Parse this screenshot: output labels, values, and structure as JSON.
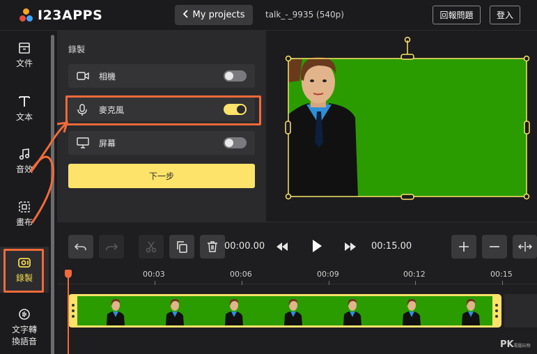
{
  "app": {
    "logo_text": "I23APPS",
    "logo_colors": [
      "#f5a623",
      "#e94e3c",
      "#3ea6ff"
    ]
  },
  "header": {
    "back_label": "My projects",
    "filename": "talk_-_9935 (540p)",
    "feedback_label": "回報問題",
    "login_label": "登入"
  },
  "sidebar": {
    "items": [
      {
        "label": "文件",
        "icon": "file-icon"
      },
      {
        "label": "文本",
        "icon": "text-icon"
      },
      {
        "label": "音效",
        "icon": "music-note-icon"
      },
      {
        "label": "畫布",
        "icon": "canvas-icon"
      },
      {
        "label": "錄製",
        "icon": "record-icon",
        "active": true
      },
      {
        "label": "文字轉換語音",
        "label_line1": "文字轉",
        "label_line2": "換語音",
        "icon": "text-to-speech-icon"
      }
    ]
  },
  "record_panel": {
    "title": "錄製",
    "options": [
      {
        "label": "相機",
        "icon": "camera-icon",
        "enabled": false
      },
      {
        "label": "麥克風",
        "icon": "microphone-icon",
        "enabled": true
      },
      {
        "label": "屏幕",
        "icon": "monitor-icon",
        "enabled": false
      }
    ],
    "next_label": "下一步"
  },
  "timeline": {
    "current_time": "00:00.00",
    "total_time": "00:15.00",
    "ruler": [
      "00:03",
      "00:06",
      "00:09",
      "00:12",
      "00:15"
    ],
    "clip_frame_count": 7
  },
  "colors": {
    "accent_yellow": "#fde36a",
    "highlight_orange": "#f26a3a",
    "green_screen": "#2a9c00"
  },
  "watermark": {
    "main": "PK",
    "sub": "電腦玩物"
  }
}
